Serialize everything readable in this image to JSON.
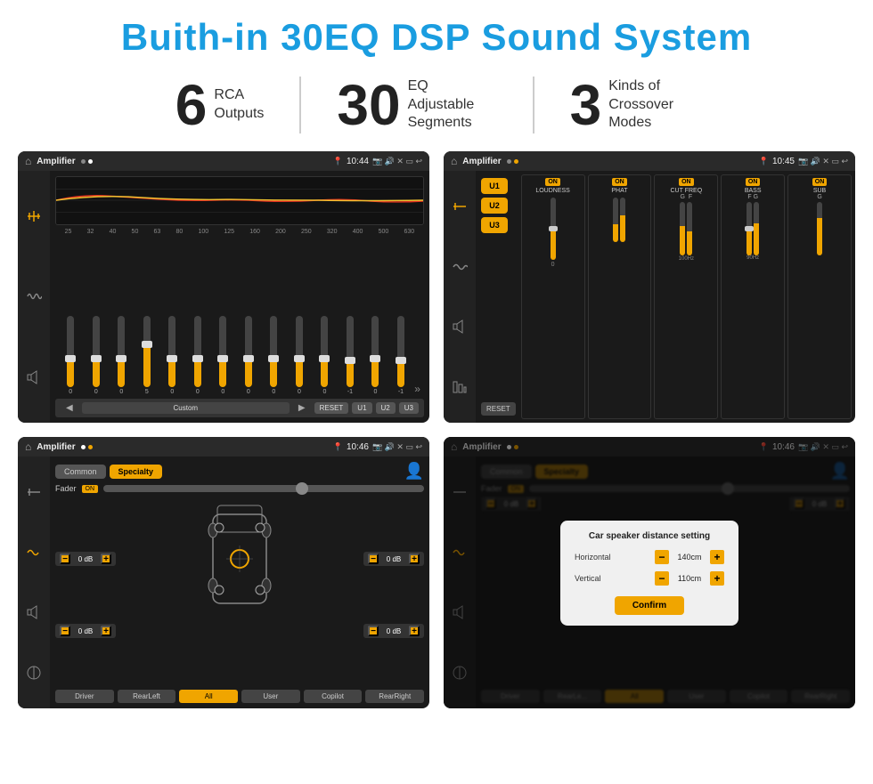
{
  "header": {
    "title": "Buith-in 30EQ DSP Sound System"
  },
  "stats": [
    {
      "number": "6",
      "text": "RCA\nOutputs"
    },
    {
      "number": "30",
      "text": "EQ Adjustable\nSegments"
    },
    {
      "number": "3",
      "text": "Kinds of\nCrossover Modes"
    }
  ],
  "screens": [
    {
      "id": "eq-screen",
      "statusBar": {
        "appName": "Amplifier",
        "time": "10:44"
      },
      "type": "eq"
    },
    {
      "id": "crossover-screen",
      "statusBar": {
        "appName": "Amplifier",
        "time": "10:45"
      },
      "type": "crossover"
    },
    {
      "id": "fader-screen",
      "statusBar": {
        "appName": "Amplifier",
        "time": "10:46"
      },
      "type": "fader"
    },
    {
      "id": "dialog-screen",
      "statusBar": {
        "appName": "Amplifier",
        "time": "10:46"
      },
      "type": "fader-dialog"
    }
  ],
  "eq": {
    "bands": [
      "25",
      "32",
      "40",
      "50",
      "63",
      "80",
      "100",
      "125",
      "160",
      "200",
      "250",
      "320",
      "400",
      "500",
      "630"
    ],
    "values": [
      "0",
      "0",
      "0",
      "5",
      "0",
      "0",
      "0",
      "0",
      "0",
      "0",
      "-1",
      "0",
      "-1"
    ],
    "preset": "Custom",
    "buttons": [
      "RESET",
      "U1",
      "U2",
      "U3"
    ]
  },
  "crossover": {
    "presets": [
      "U1",
      "U2",
      "U3"
    ],
    "channels": [
      {
        "name": "LOUDNESS",
        "on": true
      },
      {
        "name": "PHAT",
        "on": true
      },
      {
        "name": "CUT FREQ",
        "on": true
      },
      {
        "name": "BASS",
        "on": true
      },
      {
        "name": "SUB",
        "on": true
      }
    ]
  },
  "fader": {
    "tabs": [
      "Common",
      "Specialty"
    ],
    "activeTab": "Specialty",
    "faderLabel": "Fader",
    "faderOn": "ON",
    "volRows": [
      {
        "label": "0 dB"
      },
      {
        "label": "0 dB"
      },
      {
        "label": "0 dB"
      },
      {
        "label": "0 dB"
      }
    ],
    "bottomBtns": [
      "Driver",
      "All",
      "User",
      "RearLeft",
      "Copilot",
      "RearRight"
    ]
  },
  "dialog": {
    "title": "Car speaker distance setting",
    "horizontal": {
      "label": "Horizontal",
      "value": "140cm"
    },
    "vertical": {
      "label": "Vertical",
      "value": "110cm"
    },
    "confirmLabel": "Confirm"
  }
}
